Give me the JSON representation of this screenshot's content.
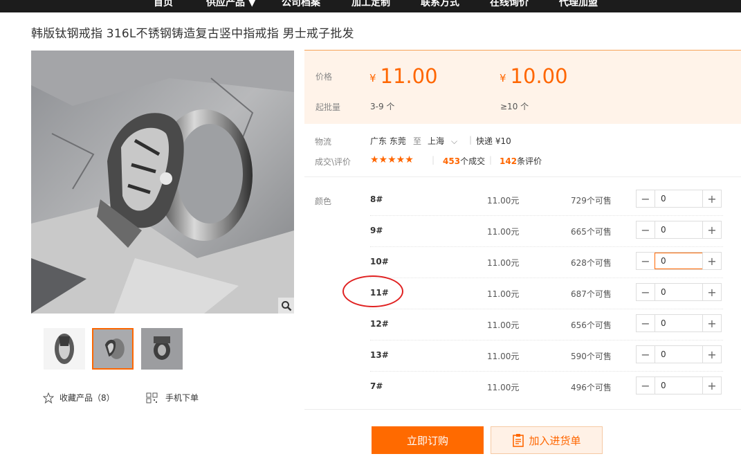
{
  "nav": {
    "items": [
      {
        "label": "首页"
      },
      {
        "label": "供应产品 ▼"
      },
      {
        "label": "公司档案"
      },
      {
        "label": "加工定制"
      },
      {
        "label": "联系方式"
      },
      {
        "label": "在线询价"
      },
      {
        "label": "代理加盟"
      }
    ]
  },
  "product": {
    "title": "韩版钛钢戒指 316L不锈钢铸造复古竖中指戒指 男士戒子批发"
  },
  "gallery": {
    "favorite_label": "收藏产品（8）",
    "mobile_label": "手机下单",
    "active_thumb": 2
  },
  "pricing": {
    "price_label": "价格",
    "moq_label": "起批量",
    "currency": "¥",
    "tiers": [
      {
        "price": "11.00",
        "range": "3-9 个"
      },
      {
        "price": "10.00",
        "range": "≥10 个"
      }
    ]
  },
  "logistics": {
    "label": "物流",
    "from": "广东 东莞",
    "to_word": "至",
    "to": "上海",
    "chevron": "⌵",
    "express": "快递 ¥10",
    "deals_label": "成交\\评价",
    "stars": "★★★★★",
    "deals_count": "453",
    "deals_suffix": "个成交",
    "reviews_count": "142",
    "reviews_suffix": "条评价"
  },
  "sku": {
    "label": "颜色",
    "rows": [
      {
        "name": "8#",
        "price": "11.00元",
        "stock": "729个可售",
        "qty": "0"
      },
      {
        "name": "9#",
        "price": "11.00元",
        "stock": "665个可售",
        "qty": "0"
      },
      {
        "name": "10#",
        "price": "11.00元",
        "stock": "628个可售",
        "qty": "0"
      },
      {
        "name": "11#",
        "price": "11.00元",
        "stock": "687个可售",
        "qty": "0"
      },
      {
        "name": "12#",
        "price": "11.00元",
        "stock": "656个可售",
        "qty": "0"
      },
      {
        "name": "13#",
        "price": "11.00元",
        "stock": "590个可售",
        "qty": "0"
      },
      {
        "name": "7#",
        "price": "11.00元",
        "stock": "496个可售",
        "qty": "0"
      }
    ],
    "minus": "−",
    "plus": "+"
  },
  "actions": {
    "buy_label": "立即订购",
    "cart_label": "加入进货单"
  },
  "colors": {
    "accent": "#ff6a00",
    "price_bg": "#fff3e9",
    "nav_bg": "#1c1c1c",
    "highlight_circle": "#e02020"
  }
}
